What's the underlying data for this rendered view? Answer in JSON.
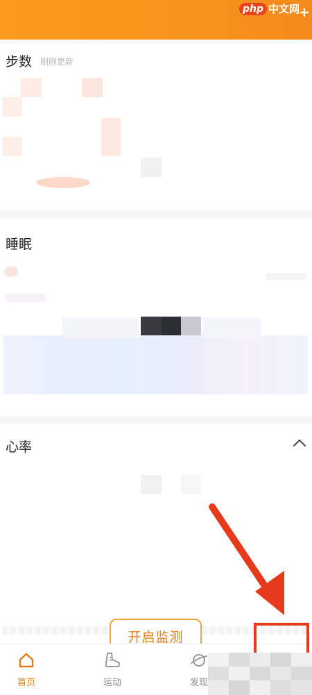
{
  "watermark": {
    "badge": "php",
    "text": "中文网"
  },
  "steps": {
    "title": "步数",
    "updated": "刚刚更新"
  },
  "sleep": {
    "title": "睡眠"
  },
  "heart": {
    "title": "心率",
    "monitor_button": "开启监测"
  },
  "nav": [
    {
      "label": "首页",
      "icon": "home-icon",
      "active": true
    },
    {
      "label": "运动",
      "icon": "sneaker-icon",
      "active": false
    },
    {
      "label": "发现",
      "icon": "planet-icon",
      "active": false
    }
  ],
  "colors": {
    "brand_orange": "#f7941d",
    "annotation_red": "#e73a1c",
    "active_nav": "#e07a16"
  }
}
